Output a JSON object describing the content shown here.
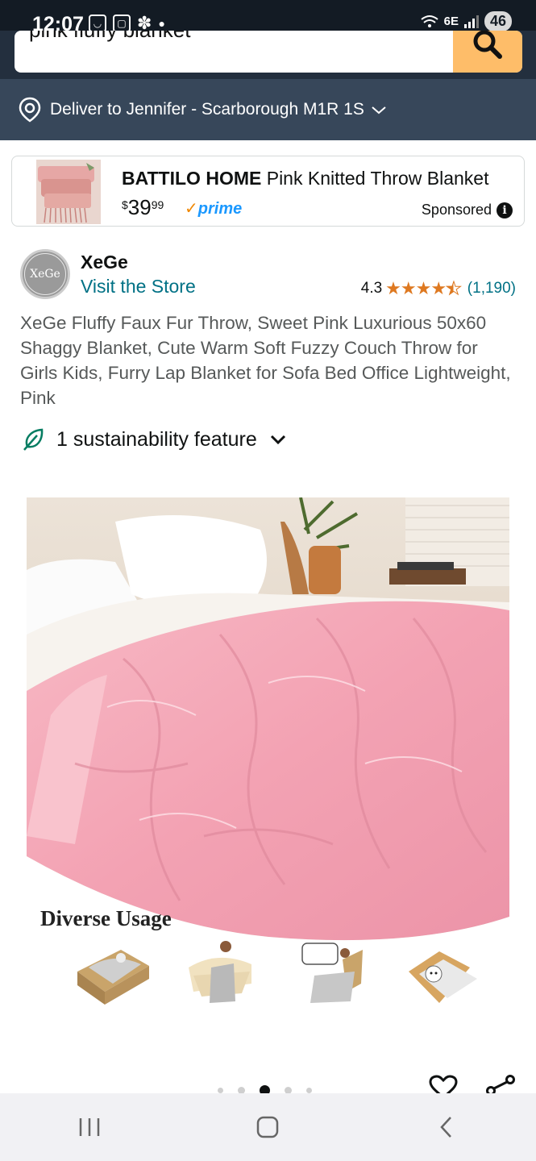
{
  "status_bar": {
    "time": "12:07",
    "signal": "6E",
    "battery": "46"
  },
  "search": {
    "value": "pink fluffy blanket"
  },
  "delivery": {
    "text": "Deliver to Jennifer - Scarborough M1R 1S"
  },
  "sponsored": {
    "brand": "BATTILO HOME",
    "title_rest": " Pink Knitted Throw Blanket",
    "price_symbol": "$",
    "price_whole": "39",
    "price_fraction": "99",
    "prime_label": "prime",
    "label": "Sponsored"
  },
  "store": {
    "logo_text": "XeGe",
    "name": "XeGe",
    "visit_link": "Visit the Store",
    "rating": "4.3",
    "stars": 4.3,
    "rating_count": "(1,190)"
  },
  "product": {
    "title": "XeGe Fluffy Faux Fur Throw, Sweet Pink Luxurious 50x60 Shaggy Blanket, Cute Warm Soft Fuzzy Couch Throw for Girls Kids, Furry Lap Blanket for Sofa Bed Office Lightweight, Pink",
    "sustainability": "1 sustainability feature",
    "image_caption": "Diverse Usage"
  },
  "carousel": {
    "count": 5,
    "active_index": 2
  },
  "colors": {
    "header_dark": "#232f3e",
    "deliver_bar": "#37475a",
    "search_button": "#febd69",
    "link": "#007185",
    "star": "#de7921",
    "prime_blue": "#1a98ff",
    "blanket_pink": "#f4a3b4"
  },
  "icons": {
    "location": "location-pin-icon",
    "search": "search-icon",
    "leaf": "leaf-icon",
    "heart": "heart-icon",
    "share": "share-icon"
  }
}
